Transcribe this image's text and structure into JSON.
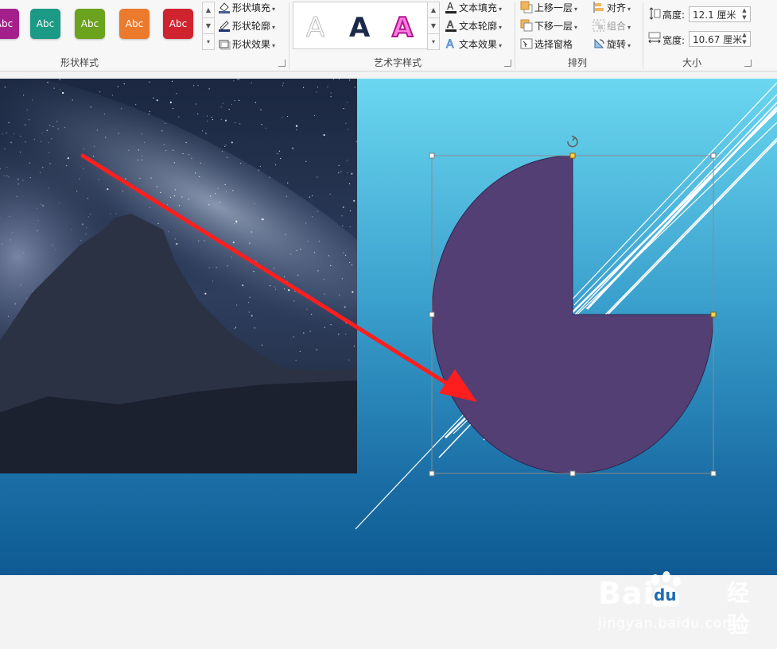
{
  "ribbon": {
    "shape_styles": {
      "group_label": "形状样式",
      "swatches": [
        {
          "label": "Abc",
          "color": "#a3208c"
        },
        {
          "label": "Abc",
          "color": "#1b9a85"
        },
        {
          "label": "Abc",
          "color": "#6ba21e"
        },
        {
          "label": "Abc",
          "color": "#ec7a2c"
        },
        {
          "label": "Abc",
          "color": "#cf2330"
        }
      ],
      "fill_label": "形状填充",
      "outline_label": "形状轮廓",
      "effects_label": "形状效果"
    },
    "wordart_styles": {
      "group_label": "艺术字样式",
      "samples": [
        "A",
        "A",
        "A"
      ],
      "text_fill_label": "文本填充",
      "text_outline_label": "文本轮廓",
      "text_effects_label": "文本效果"
    },
    "arrange": {
      "group_label": "排列",
      "bring_forward_label": "上移一层",
      "send_backward_label": "下移一层",
      "selection_pane_label": "选择窗格",
      "align_label": "对齐",
      "group_label_btn": "组合",
      "rotate_label": "旋转"
    },
    "size": {
      "group_label": "大小",
      "height_label": "高度:",
      "height_value": "12.1 厘米",
      "width_label": "宽度:",
      "width_value": "10.67 厘米"
    }
  },
  "canvas": {
    "shape_fill": "#533f74",
    "arrow_color": "#ff1e1e"
  },
  "watermark": {
    "main": "Bai",
    "du": "du",
    "cn": "经验",
    "sub": "jingyan.baidu.com"
  }
}
